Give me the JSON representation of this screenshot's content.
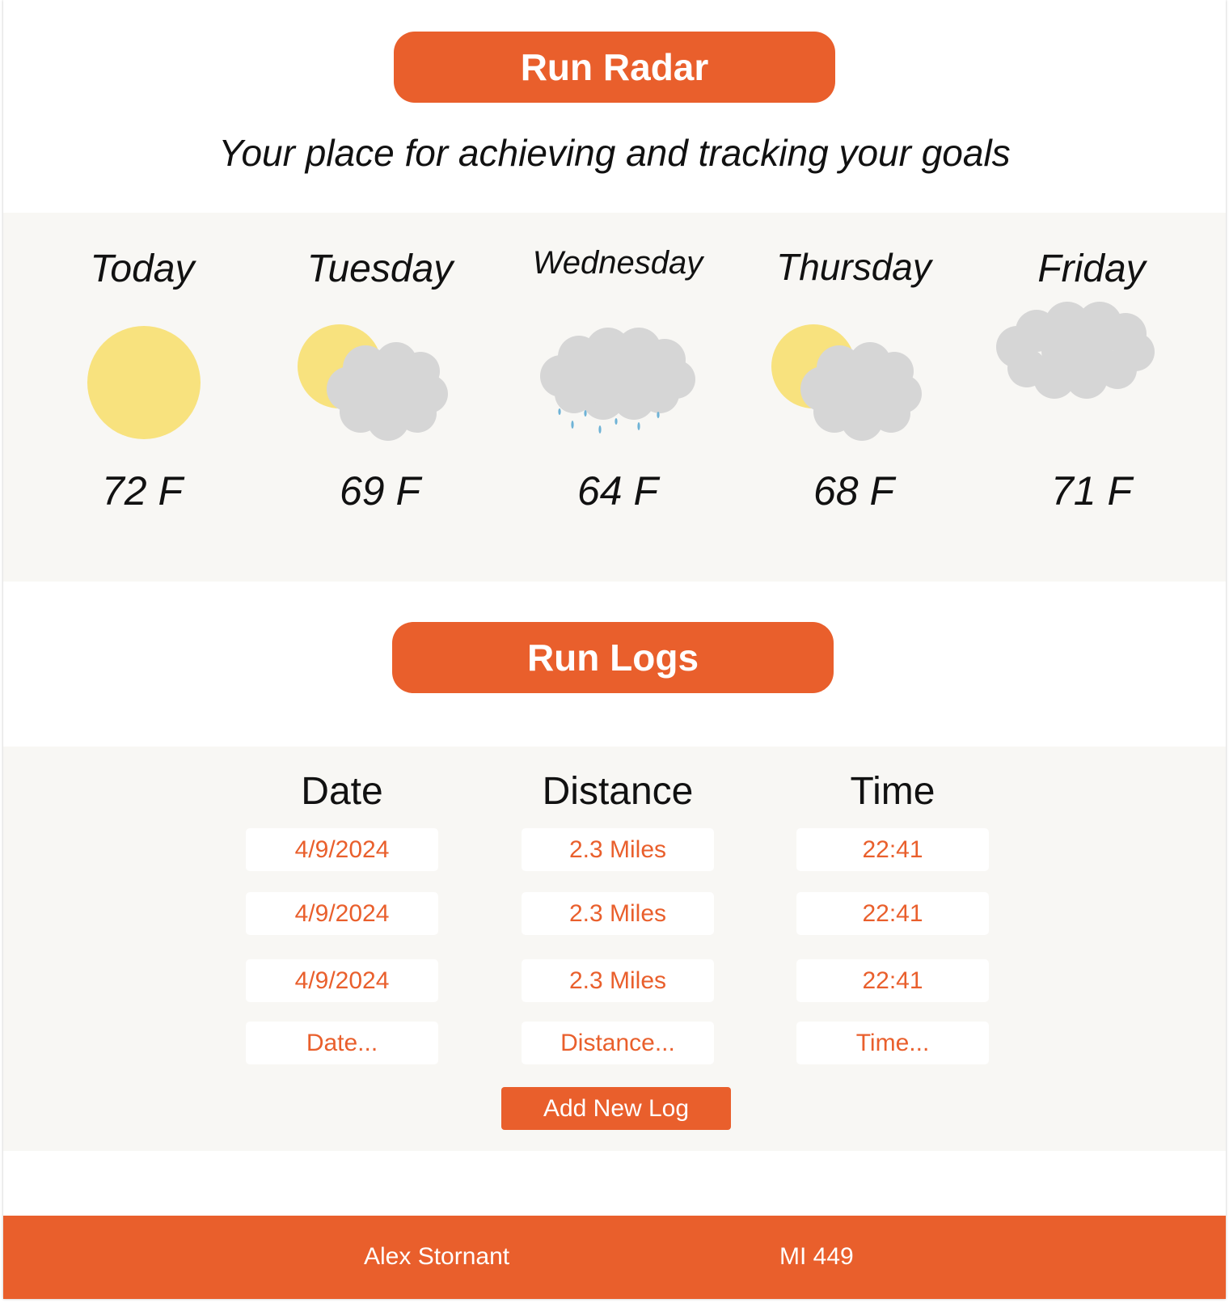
{
  "header": {
    "title": "Run Radar",
    "tagline": "Your place for achieving and tracking your goals"
  },
  "forecast": [
    {
      "day": "Today",
      "temp": "72 F",
      "icon": "sun-icon"
    },
    {
      "day": "Tuesday",
      "temp": "69 F",
      "icon": "partly-cloudy-icon"
    },
    {
      "day": "Wednesday",
      "temp": "64 F",
      "icon": "rain-cloud-icon"
    },
    {
      "day": "Thursday",
      "temp": "68 F",
      "icon": "partly-cloudy-icon"
    },
    {
      "day": "Friday",
      "temp": "71 F",
      "icon": "cloud-icon"
    }
  ],
  "logs": {
    "title": "Run Logs",
    "columns": [
      "Date",
      "Distance",
      "Time"
    ],
    "rows": [
      [
        "4/9/2024",
        "2.3 Miles",
        "22:41"
      ],
      [
        "4/9/2024",
        "2.3 Miles",
        "22:41"
      ],
      [
        "4/9/2024",
        "2.3 Miles",
        "22:41"
      ]
    ],
    "placeholders": [
      "Date...",
      "Distance...",
      "Time..."
    ],
    "add_button": "Add New Log"
  },
  "footer": {
    "author": "Alex Stornant",
    "course": "MI 449"
  },
  "colors": {
    "accent": "#e95f2c",
    "panel": "#f8f7f4",
    "sun": "#f8e27e",
    "cloud": "#d6d6d6",
    "rain": "#6fb3d6"
  }
}
